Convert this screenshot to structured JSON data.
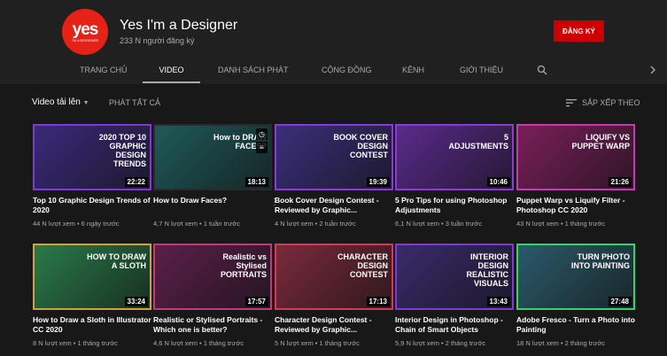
{
  "channel": {
    "logo_text": "yes",
    "logo_sub": "I'M A DESIGNER",
    "name": "Yes I'm a Designer",
    "subscribers": "233 N người đăng ký",
    "subscribe_label": "ĐĂNG KÝ"
  },
  "tabs": [
    "TRANG CHỦ",
    "VIDEO",
    "DANH SÁCH PHÁT",
    "CỘNG ĐỒNG",
    "KÊNH",
    "GIỚI THIỆU"
  ],
  "toolbar": {
    "uploads": "Video tải lên",
    "play_all": "PHÁT TẤT CẢ",
    "sort": "SẮP XẾP THEO"
  },
  "colors": {
    "subscribe": "#cc0000",
    "bg": "#181818",
    "header": "#202020"
  },
  "videos": [
    {
      "title": "Top 10 Graphic Design Trends of 2020",
      "meta": "44 N lượt xem • 6 ngày trước",
      "duration": "22:22",
      "thumb_text": "2020 TOP 10 GRAPHIC DESIGN TRENDS",
      "bg": "#3a2a7a",
      "border": "#7d3bd1"
    },
    {
      "title": "How to Draw Faces?",
      "meta": "4,7 N lượt xem • 1 tuần trước",
      "duration": "18:13",
      "thumb_text": "How to DRAW FACES?",
      "bg": "#1f5a5a",
      "border": "#2a2a2a"
    },
    {
      "title": "Book Cover Design Contest - Reviewed by Graphic...",
      "meta": "4 N lượt xem • 2 tuần trước",
      "duration": "19:39",
      "thumb_text": "BOOK COVER DESIGN CONTEST",
      "bg": "#3b2f7a",
      "border": "#8a3bd1"
    },
    {
      "title": "5 Pro Tips for using Photoshop Adjustments",
      "meta": "6,1 N lượt xem • 3 tuần trước",
      "duration": "10:46",
      "thumb_text": "5 ADJUSTMENTS",
      "bg": "#5a2a8a",
      "border": "#8a3bd1"
    },
    {
      "title": "Puppet Warp vs Liquify Filter - Photoshop CC 2020",
      "meta": "43 N lượt xem • 1 tháng trước",
      "duration": "21:26",
      "thumb_text": "LIQUIFY VS PUPPET WARP",
      "bg": "#7a1f5a",
      "border": "#c13bb1"
    },
    {
      "title": "How to Draw a Sloth in Illustrator CC 2020",
      "meta": "8 N lượt xem • 1 tháng trước",
      "duration": "33:24",
      "thumb_text": "HOW TO DRAW A SLOTH",
      "bg": "#2a7a4a",
      "border": "#d1a13b"
    },
    {
      "title": "Realistic or Stylised Portraits - Which one is better?",
      "meta": "4,6 N lượt xem • 1 tháng trước",
      "duration": "17:57",
      "thumb_text": "Realistic vs Stylised PORTRAITS",
      "bg": "#5a1f4a",
      "border": "#c13b7a"
    },
    {
      "title": "Character Design Contest - Reviewed by Graphic...",
      "meta": "5 N lượt xem • 1 tháng trước",
      "duration": "17:13",
      "thumb_text": "CHARACTER DESIGN CONTEST",
      "bg": "#7a2a3a",
      "border": "#d13b5a"
    },
    {
      "title": "Interior Design in Photoshop - Chain of Smart Objects",
      "meta": "5,9 N lượt xem • 2 tháng trước",
      "duration": "13:43",
      "thumb_text": "INTERIOR DESIGN REALISTIC VISUALS",
      "bg": "#3a2a6a",
      "border": "#7d3bd1"
    },
    {
      "title": "Adobe Fresco - Turn a Photo into Painting",
      "meta": "18 N lượt xem • 2 tháng trước",
      "duration": "27:48",
      "thumb_text": "TURN PHOTO INTO PAINTING",
      "bg": "#2a5a6a",
      "border": "#3bd16a"
    }
  ]
}
